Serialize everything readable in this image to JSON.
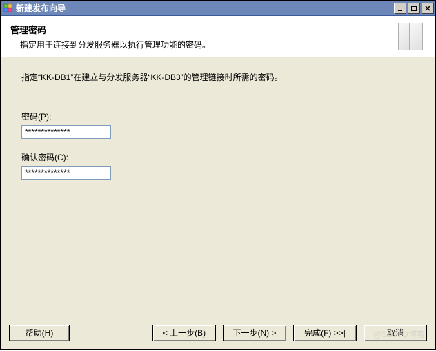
{
  "titlebar": {
    "title": "新建发布向导",
    "min_tooltip": "最小化",
    "max_tooltip": "最大化",
    "close_tooltip": "关闭"
  },
  "header": {
    "title": "管理密码",
    "subtitle": "指定用于连接到分发服务器以执行管理功能的密码。"
  },
  "content": {
    "instruction": "指定“KK-DB1”在建立与分发服务器“KK-DB3”的管理链接时所需的密码。",
    "password_label": "密码(P):",
    "password_value": "**************",
    "confirm_label": "确认密码(C):",
    "confirm_value": "**************"
  },
  "buttons": {
    "help": "帮助(H)",
    "back": "< 上一步(B)",
    "next": "下一步(N) >",
    "finish": "完成(F) >>|",
    "cancel": "取消"
  },
  "watermark": "@51CTO博客"
}
